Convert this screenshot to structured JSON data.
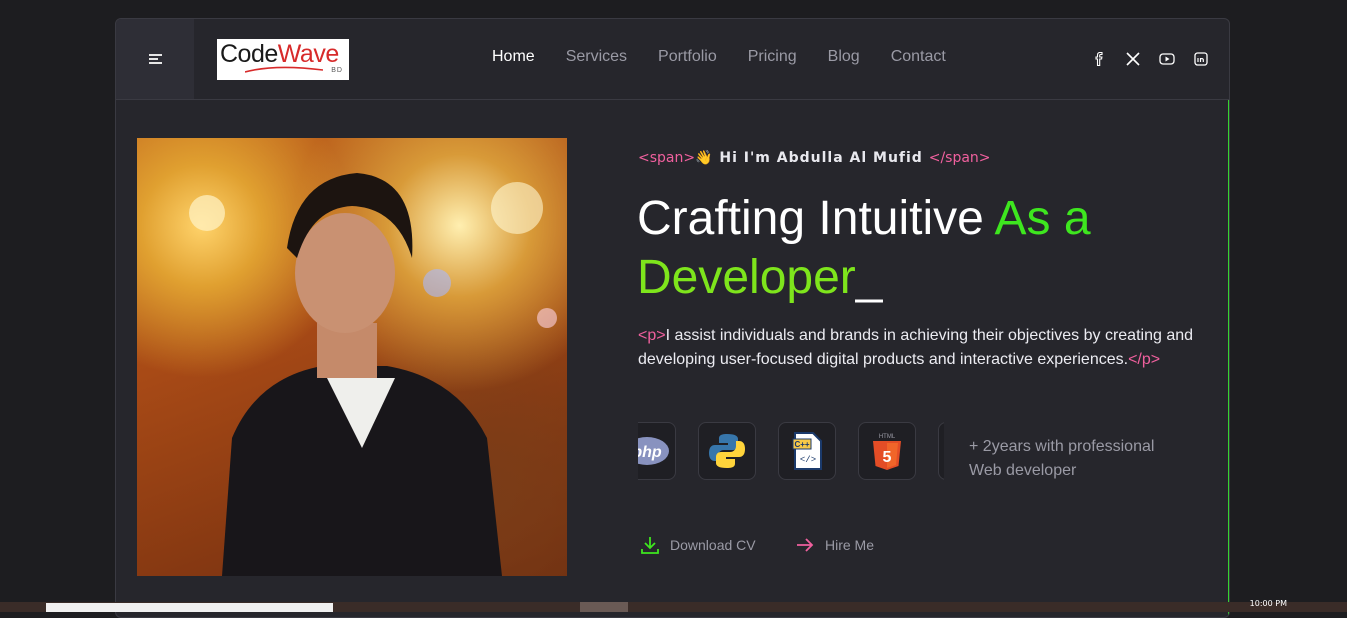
{
  "header": {
    "menu_icon": "hamburger-icon",
    "logo": {
      "code": "Code",
      "wave": "Wave",
      "suffix": "BD"
    },
    "nav": [
      {
        "label": "Home",
        "active": true
      },
      {
        "label": "Services",
        "active": false
      },
      {
        "label": "Portfolio",
        "active": false
      },
      {
        "label": "Pricing",
        "active": false
      },
      {
        "label": "Blog",
        "active": false
      },
      {
        "label": "Contact",
        "active": false
      }
    ],
    "socials": [
      "facebook-icon",
      "x-icon",
      "youtube-icon",
      "linkedin-icon"
    ]
  },
  "hero": {
    "tag_open": "<span>",
    "greeting_emoji": "👋",
    "greeting": " Hi I'm Abdulla Al Mufid",
    "tag_close": "</span>",
    "headline_part1": "Crafting Intuitive ",
    "headline_part2": "As a",
    "headline_part3": "Developer",
    "cursor": "_",
    "desc_open": "<p>",
    "description": "I assist individuals and brands in achieving their objectives by creating and developing user-focused digital products and interactive experiences.",
    "desc_close": "</p>",
    "skills": [
      "php-icon",
      "python-icon",
      "cpp-icon",
      "html5-icon"
    ],
    "experience": "+ 2years with professional Web developer",
    "download_cv": "Download CV",
    "hire_me": "Hire Me"
  },
  "taskbar": {
    "clock": "10:00 PM"
  },
  "colors": {
    "accent_green": "#3ee61f",
    "tag_pink": "#f0609e",
    "background": "#26262c"
  }
}
